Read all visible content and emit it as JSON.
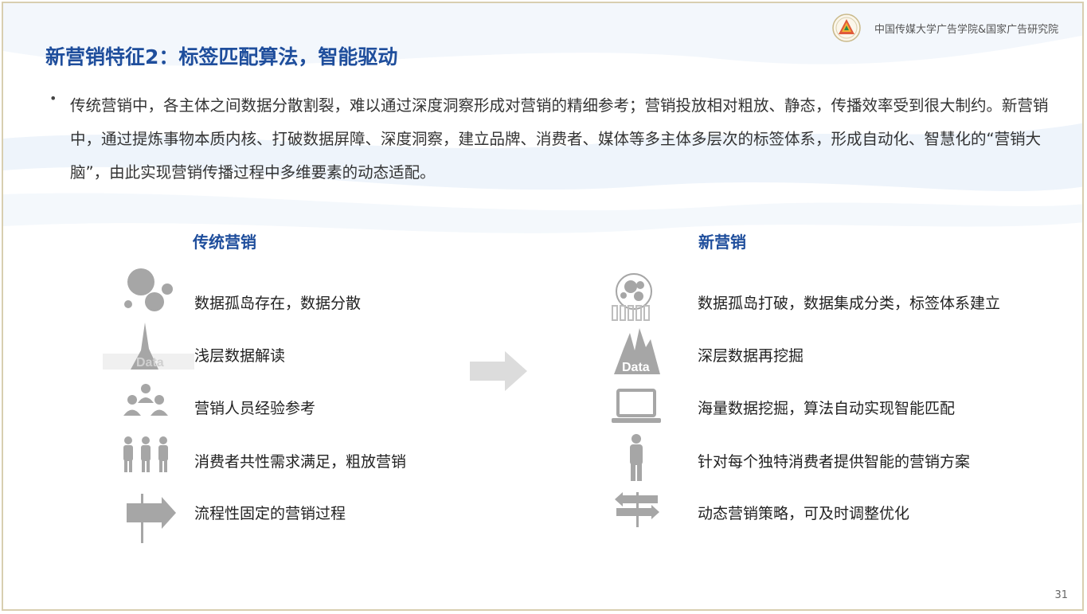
{
  "header": {
    "org_name": "中国传媒大学广告学院&国家广告研究院",
    "title": "新营销特征2：标签匹配算法，智能驱动"
  },
  "intro": {
    "bullet": "•",
    "text": "传统营销中，各主体之间数据分散割裂，难以通过深度洞察形成对营销的精细参考；营销投放相对粗放、静态，传播效率受到很大制约。新营销中，通过提炼事物本质内核、打破数据屏障、深度洞察，建立品牌、消费者、媒体等多主体多层次的标签体系，形成自动化、智慧化的“营销大脑”，由此实现营销传播过程中多维要素的动态适配。"
  },
  "traditional": {
    "heading": "传统营销",
    "items": [
      {
        "label": "数据孤岛存在，数据分散",
        "icon": "scattered-circles-icon"
      },
      {
        "label": "浅层数据解读",
        "icon": "shallow-data-mountain-icon"
      },
      {
        "label": "营销人员经验参考",
        "icon": "people-group-icon"
      },
      {
        "label": "消费者共性需求满足，粗放营销",
        "icon": "three-persons-icon"
      },
      {
        "label": "流程性固定的营销过程",
        "icon": "one-way-signpost-icon"
      }
    ]
  },
  "new": {
    "heading": "新营销",
    "items": [
      {
        "label": "数据孤岛打破，数据集成分类，标签体系建立",
        "icon": "integrated-circles-icon"
      },
      {
        "label": "深层数据再挖掘",
        "icon": "deep-data-mountain-icon"
      },
      {
        "label": "海量数据挖掘，算法自动实现智能匹配",
        "icon": "laptop-icon"
      },
      {
        "label": "针对每个独特消费者提供智能的营销方案",
        "icon": "single-person-icon"
      },
      {
        "label": "动态营销策略，可及时调整优化",
        "icon": "two-way-signpost-icon"
      }
    ]
  },
  "data_icon_text": "Data",
  "page_number": "31",
  "colors": {
    "title": "#1f4e9c",
    "icon_gray": "#a6a6a6",
    "border": "#d8ceb0"
  }
}
